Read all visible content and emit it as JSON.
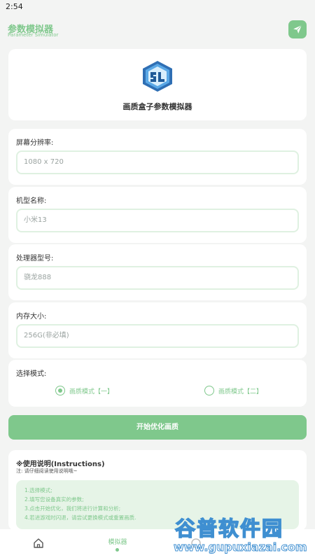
{
  "status_bar": {
    "time": "2:54"
  },
  "header": {
    "title": "参数模拟器",
    "subtitle": "Parameter Simulator",
    "send_icon": "send-icon"
  },
  "logo_card": {
    "caption": "画质盒子参数模拟器"
  },
  "fields": [
    {
      "label": "屏幕分辨率:",
      "placeholder": "1080 x 720"
    },
    {
      "label": "机型名称:",
      "placeholder": "小米13"
    },
    {
      "label": "处理器型号:",
      "placeholder": "骁龙888"
    },
    {
      "label": "内存大小:",
      "placeholder": "256G(非必填)"
    }
  ],
  "mode": {
    "label": "选择模式:",
    "options": [
      {
        "label": "画质模式【一】",
        "selected": true
      },
      {
        "label": "画质模式【二】",
        "selected": false
      }
    ]
  },
  "start_button": "开始优化画质",
  "instructions": {
    "title": "※使用说明(Instructions)",
    "note": "注: 请仔细阅读使用说明哦~",
    "steps": [
      "1.选择模式;",
      "2.填写您设备真实的参数;",
      "3.点击开始优化，我们将进行计算和分析;",
      "4.若进游戏时闪退，请尝试更换模式或重置画质."
    ]
  },
  "bottom_nav": {
    "home_icon": "home-icon",
    "simulator_label": "模拟器"
  },
  "watermark": {
    "text": "谷普软件园",
    "url": "www.gupuxiazai.com"
  },
  "colors": {
    "accent": "#7fc88c",
    "background": "#f3f4f3",
    "card": "#ffffff",
    "watermark": "#3f8fd1"
  }
}
